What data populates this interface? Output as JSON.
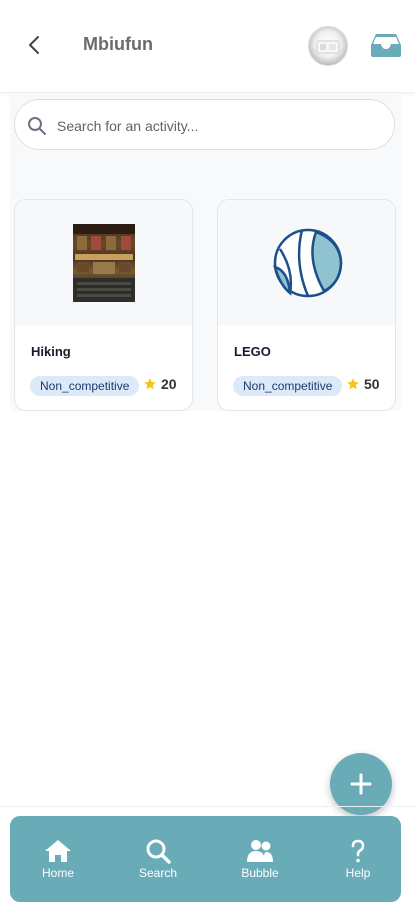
{
  "header": {
    "title": "Mbiufun",
    "back_icon": "chevron-left-icon",
    "avatar": "profile-avatar",
    "inbox_icon": "inbox-tray-icon"
  },
  "search": {
    "placeholder": "Search for an activity...",
    "value": ""
  },
  "activities": [
    {
      "name": "Hiking",
      "tag": "Non_competitive",
      "points": "20",
      "image": "theater-photo"
    },
    {
      "name": "LEGO",
      "tag": "Non_competitive",
      "points": "50",
      "image": "ball-icon"
    }
  ],
  "fab": {
    "icon": "plus-icon"
  },
  "nav": {
    "items": [
      {
        "label": "Home",
        "icon": "home-icon"
      },
      {
        "label": "Search",
        "icon": "search-icon"
      },
      {
        "label": "Bubble",
        "icon": "users-icon"
      },
      {
        "label": "Help",
        "icon": "question-icon"
      }
    ]
  },
  "colors": {
    "accent": "#6aabb8",
    "tag_bg": "#dbe9f8",
    "star": "#f5c518",
    "ball_stroke": "#1e4f8a",
    "ball_fill": "#8ec3cf"
  }
}
